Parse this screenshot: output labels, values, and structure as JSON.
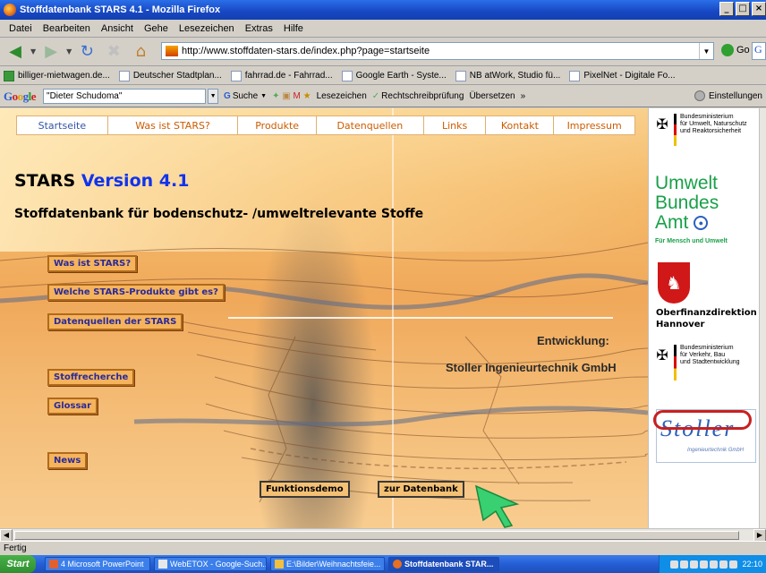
{
  "window": {
    "title": "Stoffdatenbank STARS 4.1 - Mozilla Firefox",
    "controls": [
      "_",
      "□",
      "×"
    ]
  },
  "menubar": [
    "Datei",
    "Bearbeiten",
    "Ansicht",
    "Gehe",
    "Lesezeichen",
    "Extras",
    "Hilfe"
  ],
  "navbar": {
    "url": "http://www.stoffdaten-stars.de/index.php?page=startseite",
    "go_label": "Go",
    "search_letter": "G"
  },
  "bookmarks": [
    "billiger-mietwagen.de...",
    "Deutscher Stadtplan...",
    "fahrrad.de - Fahrrad...",
    "Google Earth - Syste...",
    "NB atWork, Studio fü...",
    "PixelNet - Digitale Fo..."
  ],
  "googlebar": {
    "logo": "Google",
    "query": "\"Dieter Schudoma\"",
    "items": [
      "Suche",
      "Lesezeichen",
      "Rechtschreibprüfung",
      "Übersetzen",
      "»"
    ],
    "settings": "Einstellungen"
  },
  "page": {
    "nav": [
      {
        "label": "Startseite",
        "active": true
      },
      {
        "label": "Was ist STARS?",
        "active": false
      },
      {
        "label": "Produkte",
        "active": false
      },
      {
        "label": "Datenquellen",
        "active": false
      },
      {
        "label": "Links",
        "active": false
      },
      {
        "label": "Kontakt",
        "active": false
      },
      {
        "label": "Impressum",
        "active": false
      }
    ],
    "heading_stars": "STARS",
    "heading_version": "Version 4.1",
    "subheading": "Stoffdatenbank für bodenschutz- /umweltrelevante Stoffe",
    "side_buttons": [
      "Was ist STARS?",
      "Welche STARS-Produkte gibt es?",
      "Datenquellen der STARS",
      "Stoffrecherche",
      "Glossar",
      "News"
    ],
    "entwicklung_label": "Entwicklung:",
    "entwicklung_company": "Stoller Ingenieurtechnik GmbH",
    "demo_button": "Funktionsdemo",
    "db_button": "zur Datenbank"
  },
  "logos": {
    "bmu": [
      "Bundesministerium",
      "für Umwelt, Naturschutz",
      "und Reaktorsicherheit"
    ],
    "uba": [
      "Umwelt",
      "Bundes",
      "Amt"
    ],
    "uba_sub": "Für Mensch und Umwelt",
    "ofd": [
      "Oberfinanzdirektion",
      "Hannover"
    ],
    "bmv": [
      "Bundesministerium",
      "für Verkehr, Bau",
      "und Stadtentwicklung"
    ],
    "stoller_name": "Stoller",
    "stoller_sub": "Ingenieurtechnik GmbH"
  },
  "status": "Fertig",
  "taskbar": {
    "start": "Start",
    "items": [
      {
        "label": "4 Microsoft PowerPoint",
        "active": false
      },
      {
        "label": "WebETOX - Google-Such...",
        "active": false
      },
      {
        "label": "E:\\Bilder\\Weihnachtsfeie...",
        "active": false
      },
      {
        "label": "Stoffdatenbank STAR...",
        "active": true
      }
    ],
    "clock": "22:10"
  }
}
